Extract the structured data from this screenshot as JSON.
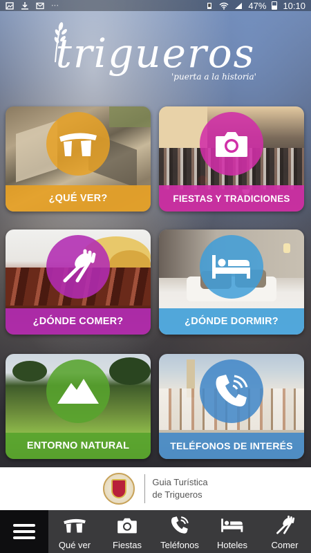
{
  "status_bar": {
    "battery_text": "47%",
    "time": "10:10",
    "overflow": "···"
  },
  "header": {
    "logo_title": "trigueros",
    "logo_subtitle": "'puerta a la historia'"
  },
  "tiles": [
    {
      "label": "¿QUÉ VER?",
      "icon": "dolmen-icon",
      "color": "#e6a126"
    },
    {
      "label": "FIESTAS Y TRADICIONES",
      "icon": "camera-icon",
      "color": "#d02fa7"
    },
    {
      "label": "¿DÓNDE COMER?",
      "icon": "fork-spoon-icon",
      "color": "#b22bb2"
    },
    {
      "label": "¿DÓNDE DORMIR?",
      "icon": "bed-icon",
      "color": "#3f9ed8"
    },
    {
      "label": "ENTORNO NATURAL",
      "icon": "mountain-icon",
      "color": "#58a42e"
    },
    {
      "label": "TELÉFONOS DE INTERÉS",
      "icon": "phone-icon",
      "color": "#4489c8"
    }
  ],
  "banner": {
    "line1": "Guia Turística",
    "line2": "de Trigueros"
  },
  "bottom_nav": {
    "items": [
      {
        "label": "Qué ver",
        "icon": "dolmen-icon"
      },
      {
        "label": "Fiestas",
        "icon": "camera-icon"
      },
      {
        "label": "Teléfonos",
        "icon": "phone-icon"
      },
      {
        "label": "Hoteles",
        "icon": "bed-icon"
      },
      {
        "label": "Comer",
        "icon": "fork-spoon-icon"
      }
    ]
  }
}
